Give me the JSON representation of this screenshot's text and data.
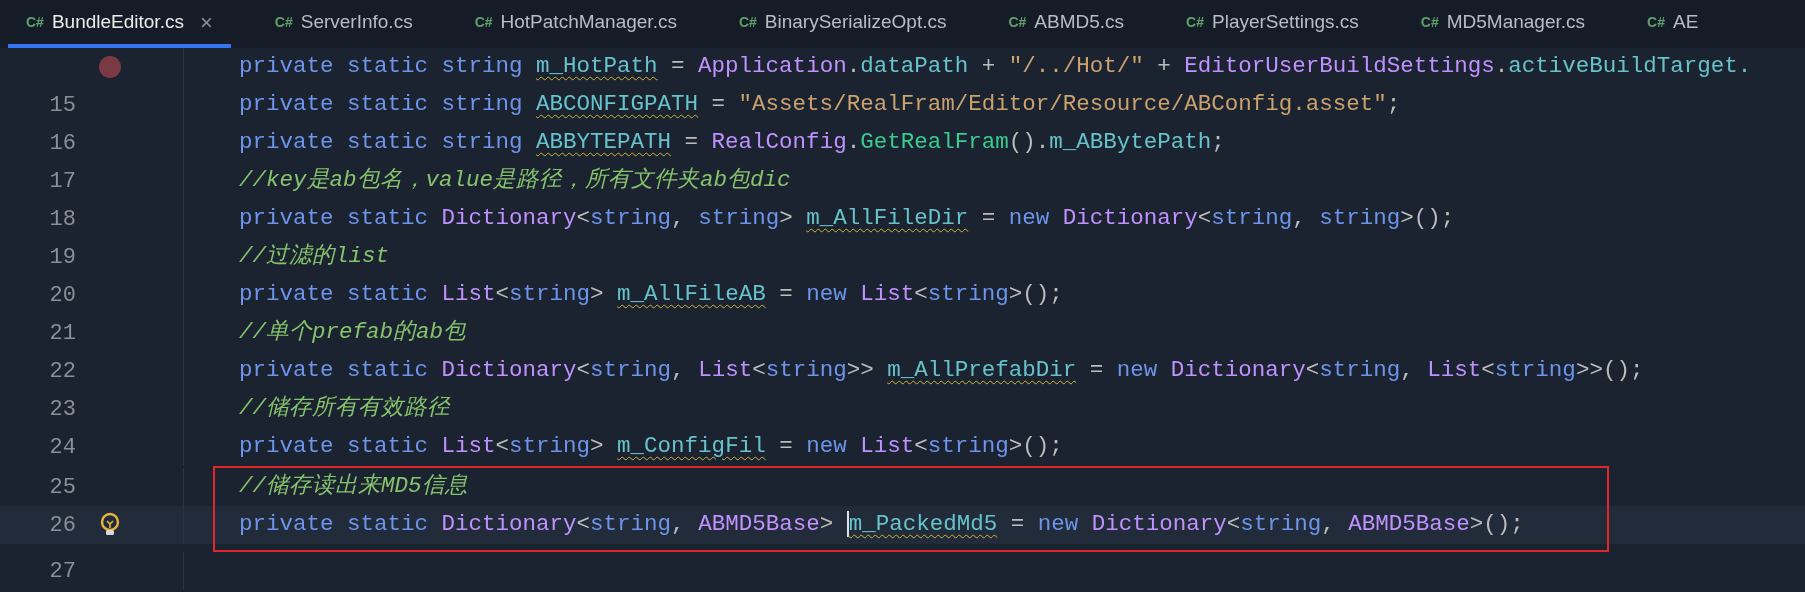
{
  "tabs": [
    {
      "label": "BundleEditor.cs",
      "lang": "C#",
      "selected": true,
      "closable": true
    },
    {
      "label": "ServerInfo.cs",
      "lang": "C#",
      "selected": false,
      "closable": false
    },
    {
      "label": "HotPatchManager.cs",
      "lang": "C#",
      "selected": false,
      "closable": false
    },
    {
      "label": "BinarySerializeOpt.cs",
      "lang": "C#",
      "selected": false,
      "closable": false
    },
    {
      "label": "ABMD5.cs",
      "lang": "C#",
      "selected": false,
      "closable": false
    },
    {
      "label": "PlayerSettings.cs",
      "lang": "C#",
      "selected": false,
      "closable": false
    },
    {
      "label": "MD5Manager.cs",
      "lang": "C#",
      "selected": false,
      "closable": false
    },
    {
      "label": "AE",
      "lang": "C#",
      "selected": false,
      "closable": false
    }
  ],
  "close_symbol": "×",
  "lines": [
    {
      "breakpoint": true,
      "tokens": [
        {
          "kind": "keyword",
          "text": "private static string "
        },
        {
          "kind": "field",
          "text": "m_HotPath",
          "warn": true
        },
        {
          "kind": "plain",
          "text": " = "
        },
        {
          "kind": "type",
          "text": "Application"
        },
        {
          "kind": "plain",
          "text": "."
        },
        {
          "kind": "field",
          "text": "dataPath"
        },
        {
          "kind": "plain",
          "text": " + "
        },
        {
          "kind": "string",
          "text": "\"/../Hot/\""
        },
        {
          "kind": "plain",
          "text": " + "
        },
        {
          "kind": "type",
          "text": "EditorUserBuildSettings"
        },
        {
          "kind": "plain",
          "text": "."
        },
        {
          "kind": "field",
          "text": "activeBuildTarget."
        }
      ]
    },
    {
      "number": "15",
      "tokens": [
        {
          "kind": "keyword",
          "text": "private static string "
        },
        {
          "kind": "field",
          "text": "ABCONFIGPATH",
          "warn": true
        },
        {
          "kind": "plain",
          "text": " = "
        },
        {
          "kind": "string",
          "text": "\"Assets/RealFram/Editor/Resource/ABConfig.asset\""
        },
        {
          "kind": "plain",
          "text": ";"
        }
      ]
    },
    {
      "number": "16",
      "tokens": [
        {
          "kind": "keyword",
          "text": "private static string "
        },
        {
          "kind": "field",
          "text": "ABBYTEPATH",
          "warn": true
        },
        {
          "kind": "plain",
          "text": " = "
        },
        {
          "kind": "type",
          "text": "RealConfig"
        },
        {
          "kind": "plain",
          "text": "."
        },
        {
          "kind": "method",
          "text": "GetRealFram"
        },
        {
          "kind": "plain",
          "text": "()."
        },
        {
          "kind": "field",
          "text": "m_ABBytePath"
        },
        {
          "kind": "plain",
          "text": ";"
        }
      ]
    },
    {
      "number": "17",
      "tokens": [
        {
          "kind": "comment",
          "text": "//key是ab包名，value是路径，所有文件夹ab包dic"
        }
      ]
    },
    {
      "number": "18",
      "tokens": [
        {
          "kind": "keyword",
          "text": "private static "
        },
        {
          "kind": "type",
          "text": "Dictionary"
        },
        {
          "kind": "plain",
          "text": "<"
        },
        {
          "kind": "keyword",
          "text": "string"
        },
        {
          "kind": "plain",
          "text": ", "
        },
        {
          "kind": "keyword",
          "text": "string"
        },
        {
          "kind": "plain",
          "text": "> "
        },
        {
          "kind": "field",
          "text": "m_AllFileDir",
          "warn": true
        },
        {
          "kind": "plain",
          "text": " = "
        },
        {
          "kind": "keyword",
          "text": "new "
        },
        {
          "kind": "type",
          "text": "Dictionary"
        },
        {
          "kind": "plain",
          "text": "<"
        },
        {
          "kind": "keyword",
          "text": "string"
        },
        {
          "kind": "plain",
          "text": ", "
        },
        {
          "kind": "keyword",
          "text": "string"
        },
        {
          "kind": "plain",
          "text": ">();"
        }
      ]
    },
    {
      "number": "19",
      "tokens": [
        {
          "kind": "comment",
          "text": "//过滤的list"
        }
      ]
    },
    {
      "number": "20",
      "tokens": [
        {
          "kind": "keyword",
          "text": "private static "
        },
        {
          "kind": "type",
          "text": "List"
        },
        {
          "kind": "plain",
          "text": "<"
        },
        {
          "kind": "keyword",
          "text": "string"
        },
        {
          "kind": "plain",
          "text": "> "
        },
        {
          "kind": "field",
          "text": "m_AllFileAB",
          "warn": true
        },
        {
          "kind": "plain",
          "text": " = "
        },
        {
          "kind": "keyword",
          "text": "new "
        },
        {
          "kind": "type",
          "text": "List"
        },
        {
          "kind": "plain",
          "text": "<"
        },
        {
          "kind": "keyword",
          "text": "string"
        },
        {
          "kind": "plain",
          "text": ">();"
        }
      ]
    },
    {
      "number": "21",
      "tokens": [
        {
          "kind": "comment",
          "text": "//单个prefab的ab包"
        }
      ]
    },
    {
      "number": "22",
      "tokens": [
        {
          "kind": "keyword",
          "text": "private static "
        },
        {
          "kind": "type",
          "text": "Dictionary"
        },
        {
          "kind": "plain",
          "text": "<"
        },
        {
          "kind": "keyword",
          "text": "string"
        },
        {
          "kind": "plain",
          "text": ", "
        },
        {
          "kind": "type",
          "text": "List"
        },
        {
          "kind": "plain",
          "text": "<"
        },
        {
          "kind": "keyword",
          "text": "string"
        },
        {
          "kind": "plain",
          "text": ">> "
        },
        {
          "kind": "field",
          "text": "m_AllPrefabDir",
          "warn": true
        },
        {
          "kind": "plain",
          "text": " = "
        },
        {
          "kind": "keyword",
          "text": "new "
        },
        {
          "kind": "type",
          "text": "Dictionary"
        },
        {
          "kind": "plain",
          "text": "<"
        },
        {
          "kind": "keyword",
          "text": "string"
        },
        {
          "kind": "plain",
          "text": ", "
        },
        {
          "kind": "type",
          "text": "List"
        },
        {
          "kind": "plain",
          "text": "<"
        },
        {
          "kind": "keyword",
          "text": "string"
        },
        {
          "kind": "plain",
          "text": ">>();"
        }
      ]
    },
    {
      "number": "23",
      "tokens": [
        {
          "kind": "comment",
          "text": "//储存所有有效路径"
        }
      ]
    },
    {
      "number": "24",
      "tokens": [
        {
          "kind": "keyword",
          "text": "private static "
        },
        {
          "kind": "type",
          "text": "List"
        },
        {
          "kind": "plain",
          "text": "<"
        },
        {
          "kind": "keyword",
          "text": "string"
        },
        {
          "kind": "plain",
          "text": "> "
        },
        {
          "kind": "field",
          "text": "m_ConfigFil",
          "warn": true
        },
        {
          "kind": "plain",
          "text": " = "
        },
        {
          "kind": "keyword",
          "text": "new "
        },
        {
          "kind": "type",
          "text": "List"
        },
        {
          "kind": "plain",
          "text": "<"
        },
        {
          "kind": "keyword",
          "text": "string"
        },
        {
          "kind": "plain",
          "text": ">();"
        }
      ]
    },
    {
      "number": "25",
      "boxed": true,
      "tokens": [
        {
          "kind": "comment",
          "text": "//储存读出来MD5信息"
        }
      ]
    },
    {
      "number": "26",
      "boxed": true,
      "current": true,
      "lightbulb": true,
      "tokens": [
        {
          "kind": "keyword",
          "text": "private static "
        },
        {
          "kind": "type",
          "text": "Dictionary"
        },
        {
          "kind": "plain",
          "text": "<"
        },
        {
          "kind": "keyword",
          "text": "string"
        },
        {
          "kind": "plain",
          "text": ", "
        },
        {
          "kind": "type",
          "text": "ABMD5Base"
        },
        {
          "kind": "plain",
          "text": "> "
        },
        {
          "kind": "field",
          "text": "m_PackedMd5",
          "warn": true,
          "caret": true
        },
        {
          "kind": "plain",
          "text": " = "
        },
        {
          "kind": "keyword",
          "text": "new "
        },
        {
          "kind": "type",
          "text": "Dictionary"
        },
        {
          "kind": "plain",
          "text": "<"
        },
        {
          "kind": "keyword",
          "text": "string"
        },
        {
          "kind": "plain",
          "text": ", "
        },
        {
          "kind": "type",
          "text": "ABMD5Base"
        },
        {
          "kind": "plain",
          "text": ">();"
        }
      ]
    },
    {
      "number": "27"
    }
  ]
}
